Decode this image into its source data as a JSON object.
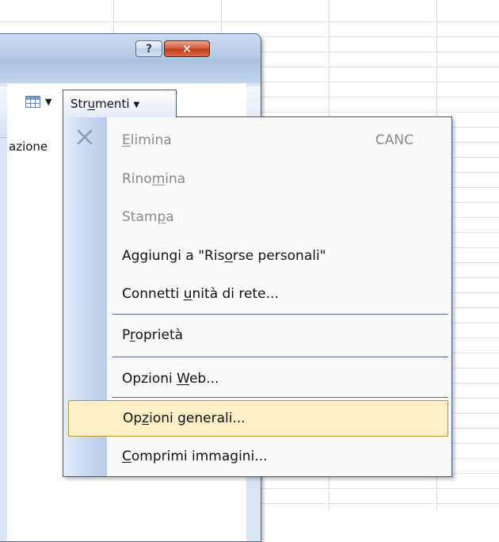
{
  "window": {
    "help_button": "?",
    "close_button": "✕"
  },
  "toolbar": {
    "partial_label": "azione",
    "dropdown_arrow": "▼"
  },
  "menu_button": {
    "pre": "Str",
    "key": "u",
    "post": "menti",
    "arrow": "▼"
  },
  "menu": {
    "items": [
      {
        "pre": "",
        "key": "E",
        "post": "limina",
        "shortcut": "CANC",
        "enabled": false
      },
      {
        "pre": "Rino",
        "key": "m",
        "post": "ina",
        "enabled": false
      },
      {
        "pre": "Stam",
        "key": "p",
        "post": "a",
        "enabled": false
      },
      {
        "pre": "Aggiungi a \"Ris",
        "key": "o",
        "post": "rse personali\"",
        "enabled": true
      },
      {
        "pre": "Connetti ",
        "key": "u",
        "post": "nità di rete...",
        "enabled": true
      },
      {
        "pre": "P",
        "key": "r",
        "post": "oprietà",
        "enabled": true
      },
      {
        "pre": "Opzioni ",
        "key": "W",
        "post": "eb...",
        "enabled": true
      },
      {
        "pre": "Op",
        "key": "z",
        "post": "ioni generali...",
        "enabled": true,
        "highlighted": true
      },
      {
        "pre": "",
        "key": "C",
        "post": "omprimi immagini...",
        "enabled": true
      }
    ]
  },
  "icons": {
    "delete": "x-icon",
    "view": "view-grid-icon",
    "help": "question-icon",
    "close": "close-icon"
  },
  "colors": {
    "highlight": "#fbefc6",
    "highlight_border": "#b89838",
    "disabled_text": "#8a8a8a",
    "menu_border": "#3d5a8a"
  }
}
